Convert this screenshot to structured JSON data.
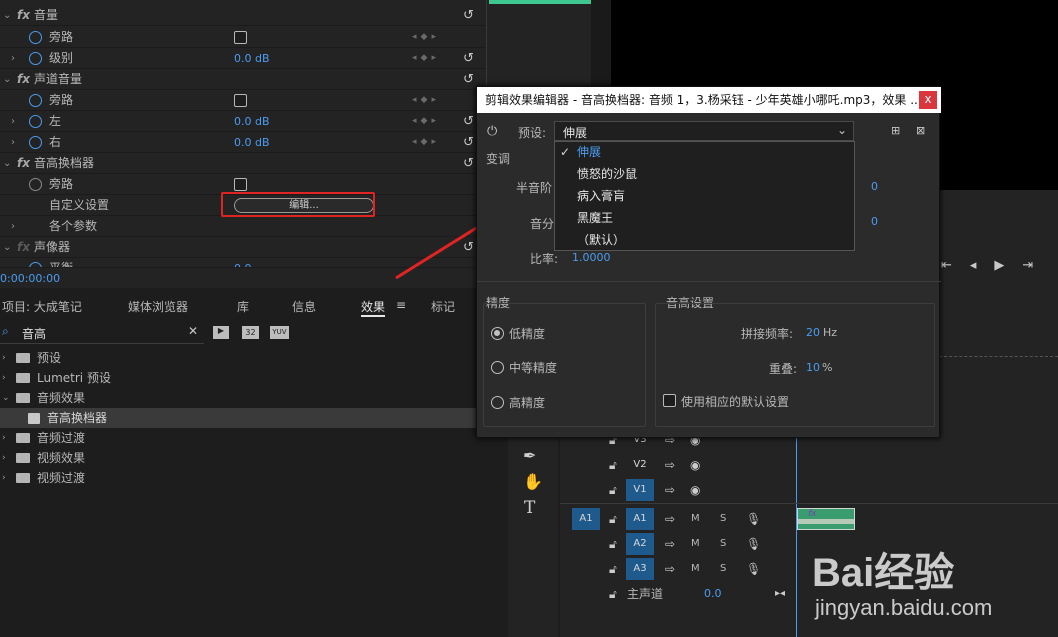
{
  "effect_controls": {
    "rows": [
      {
        "label": "音量",
        "value": ""
      },
      {
        "label": "旁路",
        "value": ""
      },
      {
        "label": "级别",
        "value": "0.0 dB"
      },
      {
        "label": "声道音量",
        "value": ""
      },
      {
        "label": "旁路",
        "value": ""
      },
      {
        "label": "左",
        "value": "0.0 dB"
      },
      {
        "label": "右",
        "value": "0.0 dB"
      },
      {
        "label": "音高换档器",
        "value": ""
      },
      {
        "label": "旁路",
        "value": ""
      },
      {
        "label": "自定义设置",
        "value": "编辑..."
      },
      {
        "label": "各个参数",
        "value": ""
      },
      {
        "label": "声像器",
        "value": ""
      },
      {
        "label": "平衡",
        "value": "0.0"
      }
    ],
    "timecode": "0:00:00:00"
  },
  "project_panel": {
    "tabs": [
      "项目: 大成笔记",
      "媒体浏览器",
      "库",
      "信息",
      "效果",
      "标记"
    ],
    "search_value": "音高",
    "tree": [
      {
        "label": "预设"
      },
      {
        "label": "Lumetri 预设"
      },
      {
        "label": "音频效果"
      },
      {
        "label": "音高换档器"
      },
      {
        "label": "音频过渡"
      },
      {
        "label": "视频效果"
      },
      {
        "label": "视频过渡"
      }
    ],
    "search_icons": [
      "32",
      "YUV"
    ]
  },
  "dialog": {
    "title": "剪辑效果编辑器 - 音高换档器: 音频 1，3.杨采钰 - 少年英雄小哪吒.mp3，效果 ...",
    "close": "x",
    "preset_label": "预设:",
    "preset_value": "伸展",
    "section_transpose": "变调",
    "semitone_label": "半音阶",
    "cents_label": "音分",
    "semitone_value": "0",
    "cents_value": "0",
    "ratio_label": "比率:",
    "ratio_value": "1.0000",
    "dropdown_options": [
      "伸展",
      "愤怒的沙鼠",
      "病入膏肓",
      "黑魔王",
      "（默认）"
    ],
    "precision_title": "精度",
    "precision_options": [
      "低精度",
      "中等精度",
      "高精度"
    ],
    "pitch_title": "音高设置",
    "splice_label": "拼接频率:",
    "splice_value": "20",
    "splice_unit": "Hz",
    "overlap_label": "重叠:",
    "overlap_value": "10",
    "overlap_unit": "%",
    "default_label": "使用相应的默认设置"
  },
  "timeline": {
    "video_tracks": [
      "V3",
      "V2",
      "V1"
    ],
    "audio_tracks": [
      "A1",
      "A2",
      "A3"
    ],
    "source_patch": "A1",
    "track_buttons": [
      "M",
      "S"
    ],
    "master_label": "主声道",
    "master_value": "0.0",
    "clip_label": "fx"
  },
  "watermark": {
    "brand": "Bai经验",
    "url": "jingyan.baidu.com"
  }
}
